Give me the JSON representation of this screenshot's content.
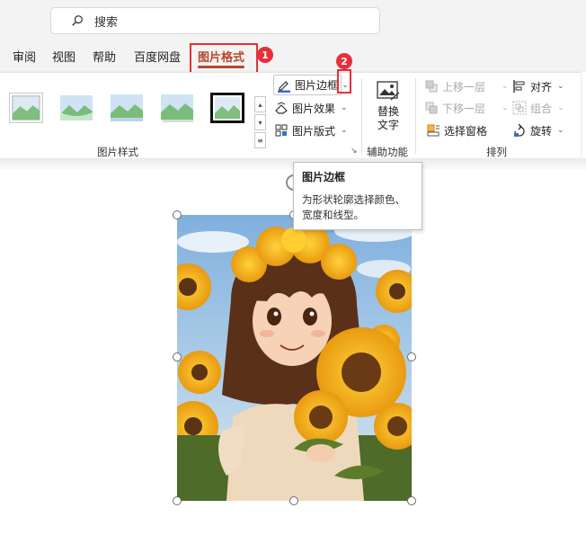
{
  "search": {
    "placeholder": "搜索"
  },
  "tabs": [
    {
      "label": "审阅"
    },
    {
      "label": "视图"
    },
    {
      "label": "帮助"
    },
    {
      "label": "百度网盘"
    },
    {
      "label": "图片格式"
    }
  ],
  "steps": {
    "one": "1",
    "two": "2"
  },
  "ribbon": {
    "picture_styles": {
      "group_label": "图片样式"
    },
    "border": {
      "label": "图片边框"
    },
    "effects": {
      "label": "图片效果"
    },
    "layout": {
      "label": "图片版式"
    },
    "alt_text": {
      "label_line1": "替换",
      "label_line2": "文字",
      "group_label": "辅助功能"
    },
    "arrange": {
      "group_label": "排列",
      "bring_forward": "上移一层",
      "send_backward": "下移一层",
      "selection_pane": "选择窗格",
      "align": "对齐",
      "group": "组合",
      "rotate": "旋转"
    }
  },
  "tooltip": {
    "title": "图片边框",
    "description": "为形状轮廓选择颜色、宽度和线型。"
  },
  "colors": {
    "accent": "#b7472a",
    "highlight": "#e5303a"
  }
}
